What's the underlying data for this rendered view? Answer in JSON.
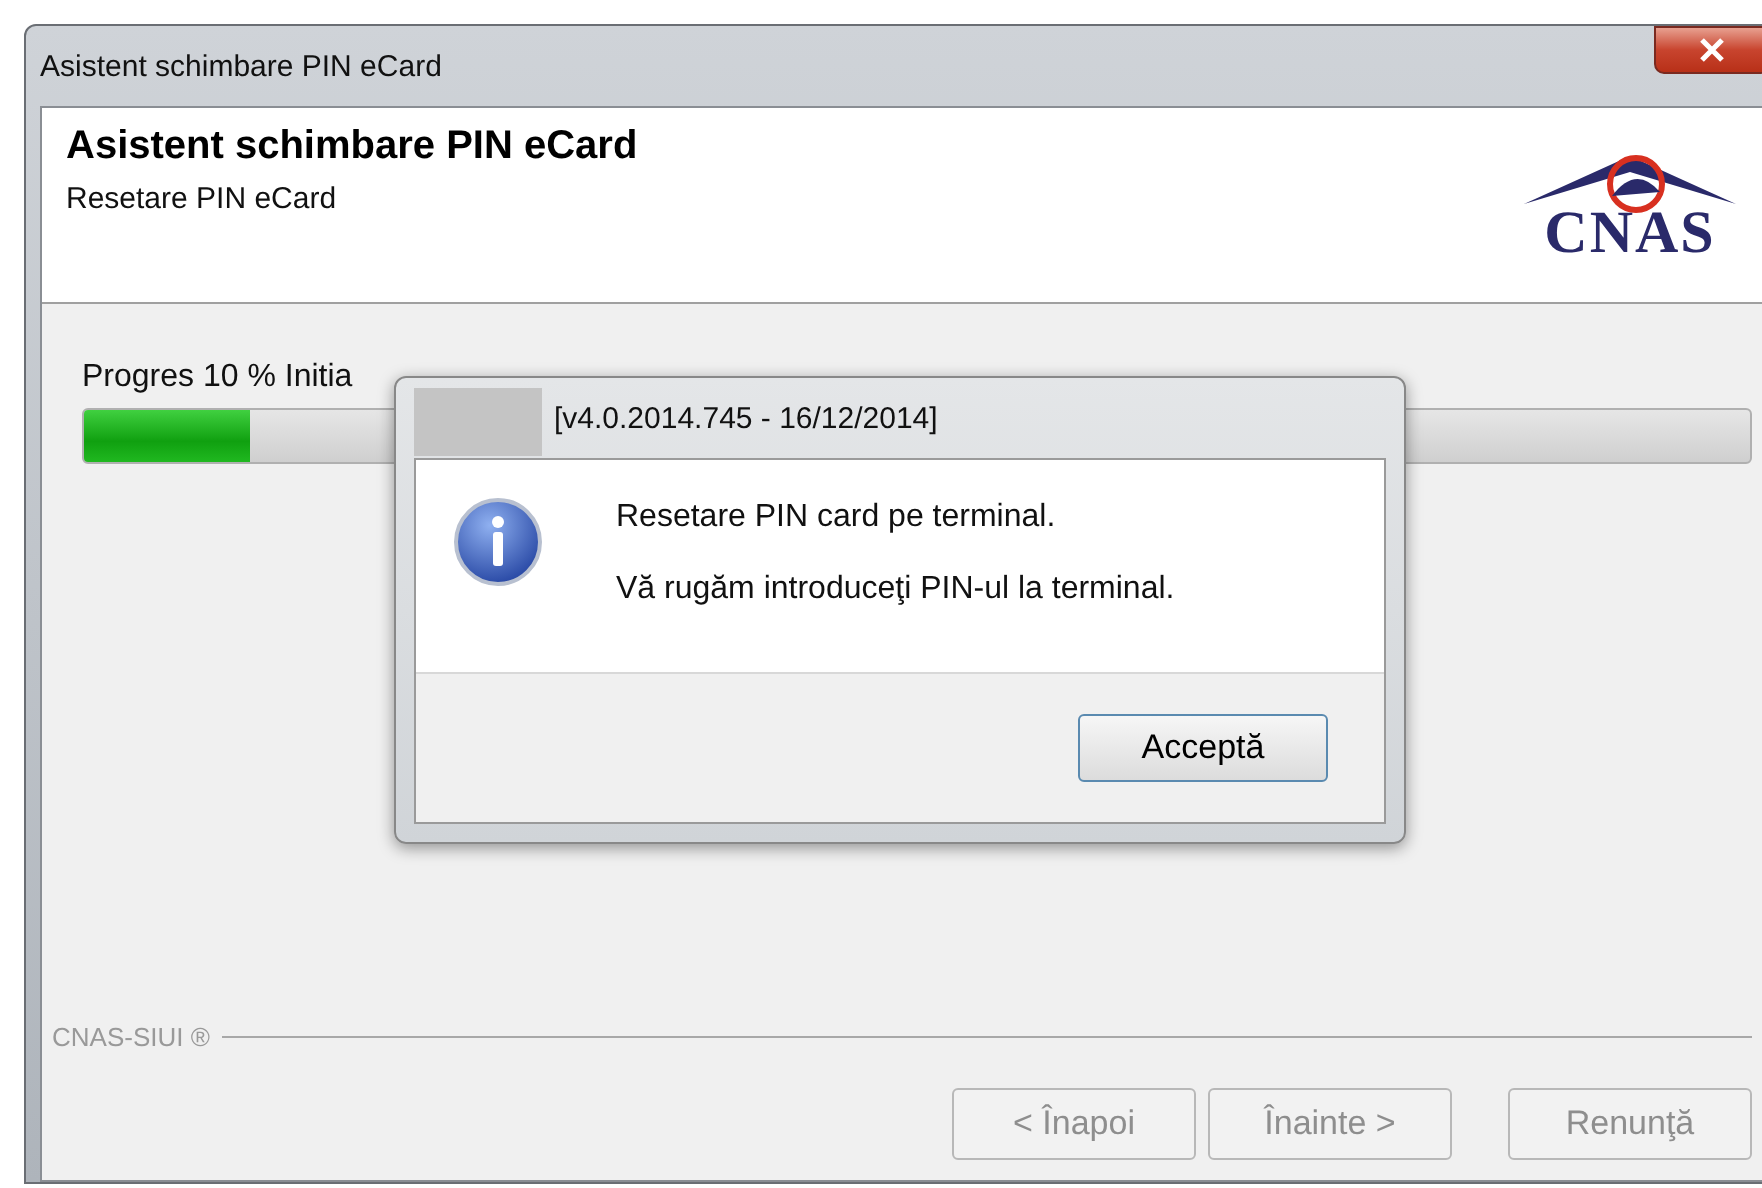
{
  "window": {
    "title": "Asistent schimbare PIN eCard"
  },
  "header": {
    "title": "Asistent schimbare PIN eCard",
    "subtitle": "Resetare PIN eCard",
    "logo_text": "CNAS"
  },
  "progress": {
    "label": "Progres 10 % Initia",
    "level": 0.1
  },
  "footer": {
    "brand": "CNAS-SIUI ®"
  },
  "buttons": [
    {
      "label": "< Înapoi",
      "disabled": true
    },
    {
      "label": "Înainte >",
      "disabled": true
    },
    {
      "label": "Renunţă",
      "disabled": true
    }
  ],
  "dialog": {
    "title": "[v4.0.2014.745 - 16/12/2014]",
    "messages": [
      "Resetare PIN card pe terminal.",
      "Vă rugăm introduceţi PIN-ul la terminal."
    ],
    "button": "Acceptă"
  }
}
